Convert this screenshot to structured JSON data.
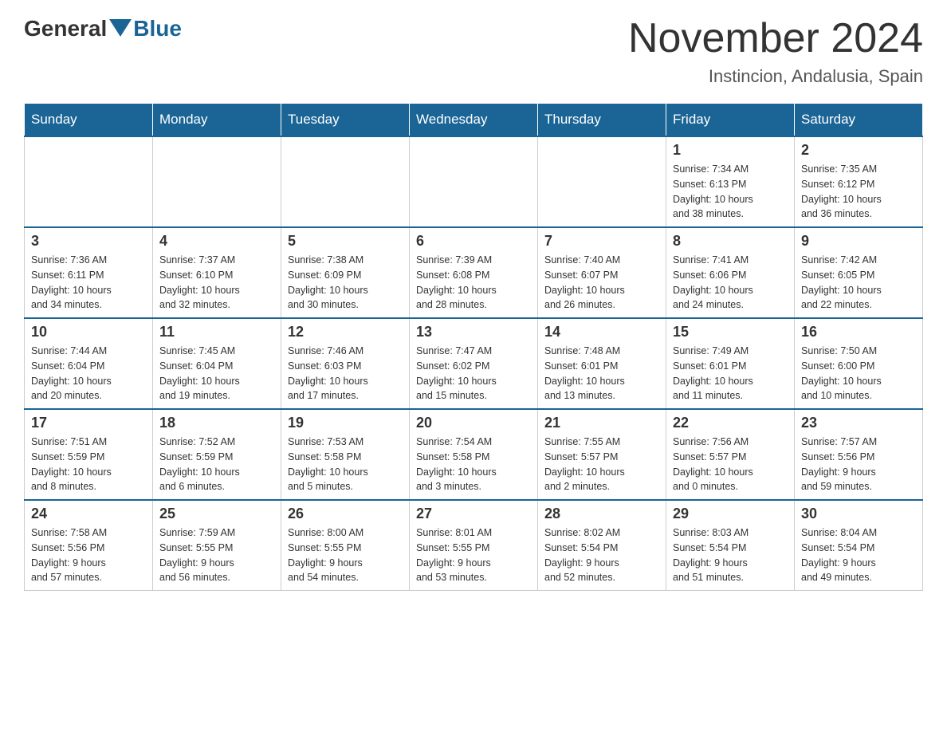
{
  "logo": {
    "general": "General",
    "blue": "Blue"
  },
  "title": "November 2024",
  "location": "Instincion, Andalusia, Spain",
  "days_of_week": [
    "Sunday",
    "Monday",
    "Tuesday",
    "Wednesday",
    "Thursday",
    "Friday",
    "Saturday"
  ],
  "weeks": [
    [
      {
        "day": "",
        "info": ""
      },
      {
        "day": "",
        "info": ""
      },
      {
        "day": "",
        "info": ""
      },
      {
        "day": "",
        "info": ""
      },
      {
        "day": "",
        "info": ""
      },
      {
        "day": "1",
        "info": "Sunrise: 7:34 AM\nSunset: 6:13 PM\nDaylight: 10 hours\nand 38 minutes."
      },
      {
        "day": "2",
        "info": "Sunrise: 7:35 AM\nSunset: 6:12 PM\nDaylight: 10 hours\nand 36 minutes."
      }
    ],
    [
      {
        "day": "3",
        "info": "Sunrise: 7:36 AM\nSunset: 6:11 PM\nDaylight: 10 hours\nand 34 minutes."
      },
      {
        "day": "4",
        "info": "Sunrise: 7:37 AM\nSunset: 6:10 PM\nDaylight: 10 hours\nand 32 minutes."
      },
      {
        "day": "5",
        "info": "Sunrise: 7:38 AM\nSunset: 6:09 PM\nDaylight: 10 hours\nand 30 minutes."
      },
      {
        "day": "6",
        "info": "Sunrise: 7:39 AM\nSunset: 6:08 PM\nDaylight: 10 hours\nand 28 minutes."
      },
      {
        "day": "7",
        "info": "Sunrise: 7:40 AM\nSunset: 6:07 PM\nDaylight: 10 hours\nand 26 minutes."
      },
      {
        "day": "8",
        "info": "Sunrise: 7:41 AM\nSunset: 6:06 PM\nDaylight: 10 hours\nand 24 minutes."
      },
      {
        "day": "9",
        "info": "Sunrise: 7:42 AM\nSunset: 6:05 PM\nDaylight: 10 hours\nand 22 minutes."
      }
    ],
    [
      {
        "day": "10",
        "info": "Sunrise: 7:44 AM\nSunset: 6:04 PM\nDaylight: 10 hours\nand 20 minutes."
      },
      {
        "day": "11",
        "info": "Sunrise: 7:45 AM\nSunset: 6:04 PM\nDaylight: 10 hours\nand 19 minutes."
      },
      {
        "day": "12",
        "info": "Sunrise: 7:46 AM\nSunset: 6:03 PM\nDaylight: 10 hours\nand 17 minutes."
      },
      {
        "day": "13",
        "info": "Sunrise: 7:47 AM\nSunset: 6:02 PM\nDaylight: 10 hours\nand 15 minutes."
      },
      {
        "day": "14",
        "info": "Sunrise: 7:48 AM\nSunset: 6:01 PM\nDaylight: 10 hours\nand 13 minutes."
      },
      {
        "day": "15",
        "info": "Sunrise: 7:49 AM\nSunset: 6:01 PM\nDaylight: 10 hours\nand 11 minutes."
      },
      {
        "day": "16",
        "info": "Sunrise: 7:50 AM\nSunset: 6:00 PM\nDaylight: 10 hours\nand 10 minutes."
      }
    ],
    [
      {
        "day": "17",
        "info": "Sunrise: 7:51 AM\nSunset: 5:59 PM\nDaylight: 10 hours\nand 8 minutes."
      },
      {
        "day": "18",
        "info": "Sunrise: 7:52 AM\nSunset: 5:59 PM\nDaylight: 10 hours\nand 6 minutes."
      },
      {
        "day": "19",
        "info": "Sunrise: 7:53 AM\nSunset: 5:58 PM\nDaylight: 10 hours\nand 5 minutes."
      },
      {
        "day": "20",
        "info": "Sunrise: 7:54 AM\nSunset: 5:58 PM\nDaylight: 10 hours\nand 3 minutes."
      },
      {
        "day": "21",
        "info": "Sunrise: 7:55 AM\nSunset: 5:57 PM\nDaylight: 10 hours\nand 2 minutes."
      },
      {
        "day": "22",
        "info": "Sunrise: 7:56 AM\nSunset: 5:57 PM\nDaylight: 10 hours\nand 0 minutes."
      },
      {
        "day": "23",
        "info": "Sunrise: 7:57 AM\nSunset: 5:56 PM\nDaylight: 9 hours\nand 59 minutes."
      }
    ],
    [
      {
        "day": "24",
        "info": "Sunrise: 7:58 AM\nSunset: 5:56 PM\nDaylight: 9 hours\nand 57 minutes."
      },
      {
        "day": "25",
        "info": "Sunrise: 7:59 AM\nSunset: 5:55 PM\nDaylight: 9 hours\nand 56 minutes."
      },
      {
        "day": "26",
        "info": "Sunrise: 8:00 AM\nSunset: 5:55 PM\nDaylight: 9 hours\nand 54 minutes."
      },
      {
        "day": "27",
        "info": "Sunrise: 8:01 AM\nSunset: 5:55 PM\nDaylight: 9 hours\nand 53 minutes."
      },
      {
        "day": "28",
        "info": "Sunrise: 8:02 AM\nSunset: 5:54 PM\nDaylight: 9 hours\nand 52 minutes."
      },
      {
        "day": "29",
        "info": "Sunrise: 8:03 AM\nSunset: 5:54 PM\nDaylight: 9 hours\nand 51 minutes."
      },
      {
        "day": "30",
        "info": "Sunrise: 8:04 AM\nSunset: 5:54 PM\nDaylight: 9 hours\nand 49 minutes."
      }
    ]
  ]
}
